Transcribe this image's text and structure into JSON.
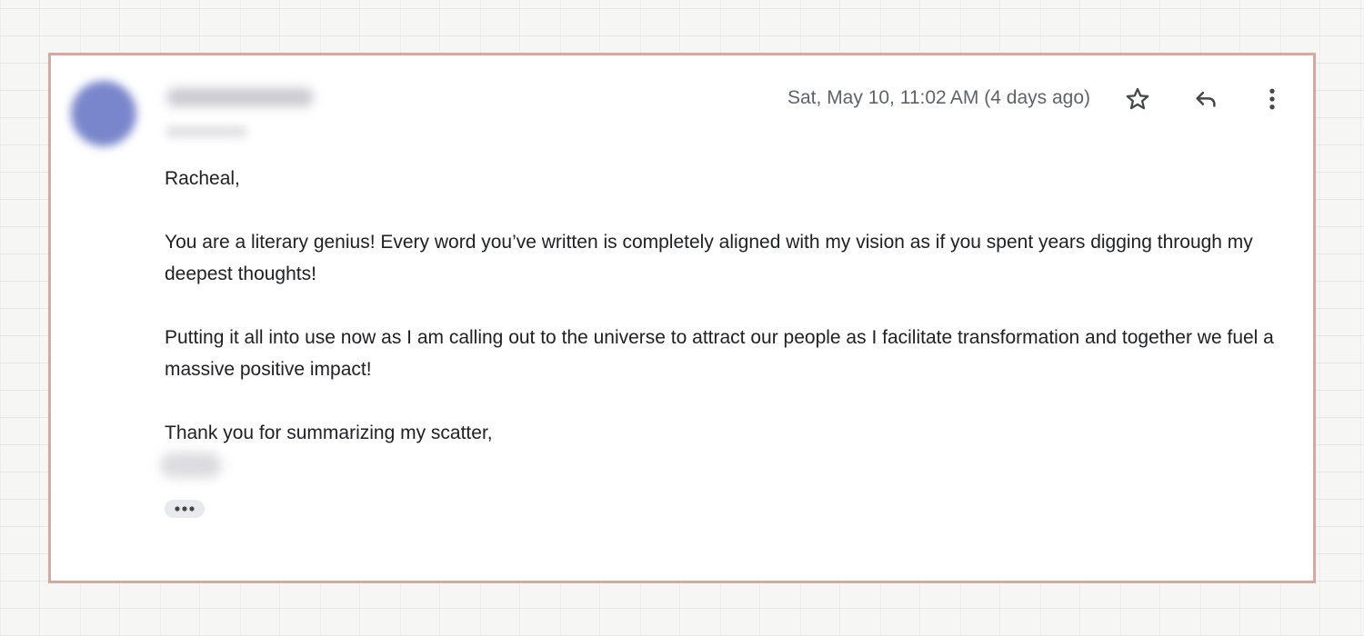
{
  "email": {
    "timestamp": "Sat, May 10, 11:02 AM (4 days ago)",
    "greeting": "Racheal,",
    "paragraphs": [
      "You are a literary genius! Every word you’ve written is completely aligned with my vision as if you spent years digging through my deepest thoughts!",
      "Putting it all into use now as I am calling out to the universe to attract our people as I facilitate transformation and together we fuel a massive positive impact!"
    ],
    "closing": "Thank you for summarizing my scatter,"
  },
  "actions": {
    "star_icon": "star-outline-icon",
    "reply_icon": "reply-arrow-icon",
    "more_icon": "vertical-dots-icon",
    "trim_icon": "horizontal-dots-icon"
  },
  "colors": {
    "frame_border": "#d4aaa0",
    "avatar": "#7986cb",
    "timestamp_text": "#5f6368",
    "body_text": "#202124",
    "icon": "#444746"
  }
}
